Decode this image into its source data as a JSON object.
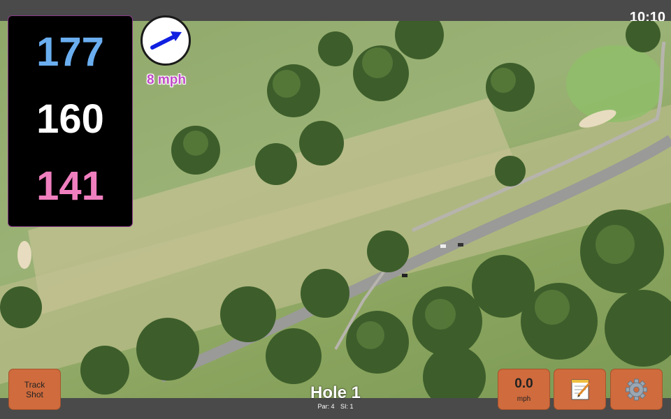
{
  "status_bar": {
    "time": "10:10"
  },
  "yardages": {
    "back": "177",
    "middle": "160",
    "front": "141"
  },
  "wind": {
    "speed": "8 mph",
    "direction_icon": "wind-arrow-icon"
  },
  "hole": {
    "title": "Hole 1",
    "par": "Par: 4",
    "stroke_index": "SI: 1"
  },
  "buttons": {
    "track_shot_line1": "Track",
    "track_shot_line2": "Shot",
    "speed_value": "0.0",
    "speed_unit": "mph",
    "notes_icon": "notepad-icon",
    "settings_icon": "gear-icon"
  },
  "colors": {
    "back_yardage": "#6aaef0",
    "middle_yardage": "#ffffff",
    "front_yardage": "#f07fbf",
    "wind_text": "#c04bc8",
    "wind_arrow": "#1020e0",
    "button_bg": "#cf6b3d"
  }
}
